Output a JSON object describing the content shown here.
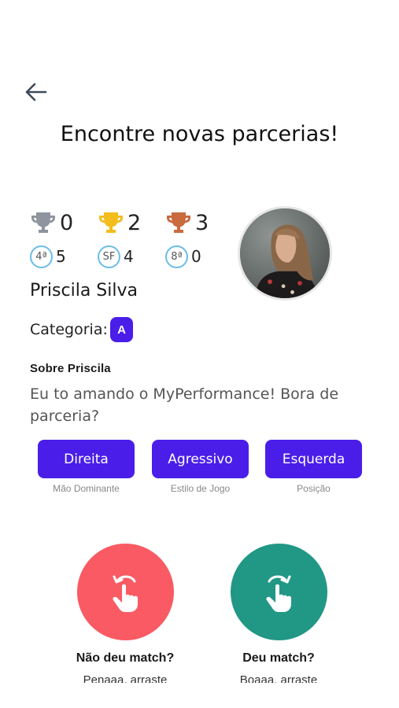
{
  "header": {
    "back_icon": "arrow-left-icon",
    "title": "Encontre novas parcerias!"
  },
  "trophies": [
    {
      "icon": "trophy-silver-icon",
      "color": "#8e959e",
      "count": "0"
    },
    {
      "icon": "trophy-gold-icon",
      "color": "#f2bd1d",
      "count": "2"
    },
    {
      "icon": "trophy-bronze-icon",
      "color": "#c96a3f",
      "count": "3"
    }
  ],
  "placements": [
    {
      "badge": "4ª",
      "count": "5"
    },
    {
      "badge": "SF",
      "count": "4"
    },
    {
      "badge": "8ª",
      "count": "0"
    }
  ],
  "profile": {
    "name": "Priscila Silva",
    "category_label": "Categoria:",
    "category_value": "A",
    "about_title": "Sobre  Priscila",
    "about_text": "Eu to amando o MyPerformance! Bora de parceria?"
  },
  "attributes": [
    {
      "value": "Direita",
      "caption": "Mão Dominante"
    },
    {
      "value": "Agressivo",
      "caption": "Estilo de Jogo"
    },
    {
      "value": "Esquerda",
      "caption": "Posição"
    }
  ],
  "actions": {
    "reject": {
      "label": "Não deu match?",
      "sub": "Penaaa, arraste",
      "color": "#fa5a63",
      "icon": "swipe-left-icon"
    },
    "accept": {
      "label": "Deu match?",
      "sub": "Boaaa, arraste",
      "color": "#219785",
      "icon": "swipe-right-icon"
    }
  },
  "colors": {
    "accent": "#4a1ee8",
    "badge_ring": "#6bbde9"
  }
}
